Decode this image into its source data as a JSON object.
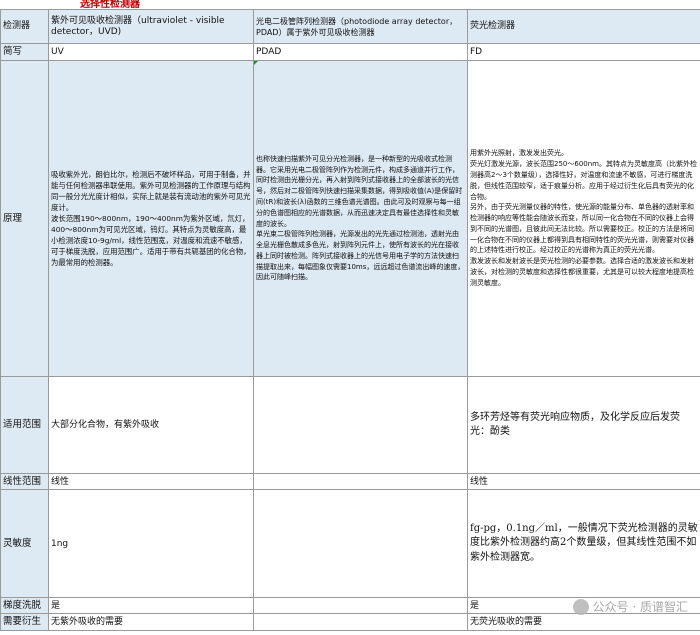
{
  "tag": "选择性检测器",
  "header": {
    "label": "检测器",
    "uv": "紫外可见吸收检测器（ultraviolet - visible detector，UVD)",
    "pdad": "光电二极管阵列检测器（photodiode array detector，PDAD）属于紫外可见吸收检测器",
    "fd": "荧光检测器"
  },
  "abbr": {
    "label": "简写",
    "uv": "UV",
    "pdad": "PDAD",
    "fd": "FD"
  },
  "principle": {
    "label": "原理",
    "uv": "吸收紫外光，朗伯比尔，检测后不破坏样品，可用于制备，并能与任何检测器串联使用。紫外可见检测器的工作原理与结构同一般分光光度计相似，实际上就是装有流动池的紫外可见光度计。\n波长范围190～800nm，190～400nm为紫外区域，氘灯，400～800nm为可见光区域，钨灯。其特点为灵敏度高，最小检测浓度10-9g/ml，线性范围宽，对温度和流速不敏感，可于梯度洗脱，应用范围广。适用于带有共轭基团的化合物，为最常用的检测器。",
    "pdad": "也称快速扫描紫外可见分光检测器，是一种新型的光吸收式检测器。它采用光电二极管阵列作为检测元件，构成多通道并行工作，同时检测由光栅分光，再入射到阵列式接收器上的全部波长的光信号，然后对二极管阵列快速扫描采集数据，得到吸收值(A)是保留时间(tR)和波长(λ)函数的三维色谱光谱图。由此可及时观察与每一组分的色谱图相应的光谱数据，从而迅速决定具有最佳选择性和灵敏度的波长。\n单光束二极管阵列检测器，光源发出的光先通过检测池，透射光由全息光栅色散成多色光，射到阵列元件上，使所有波长的光在接收器上同时被检测。阵列式接收器上的光信号用电子学的方法快速扫描提取出来，每幅图象仅需要10ms，远远超过色谱流出峰的速度，因此可随峰扫描。",
    "fd": "用紫外光照射，激发发出荧光。\n荧光灯激发光源，波长范围250～600nm。其特点为灵敏度高（比紫外检测器高2～3个数量级），选择性好，对温度和流速不敏感，可进行梯度洗脱，但线性范围较窄，适于痕量分析。应用于经过衍生化后具有荧光的化合物。\n另外，由于荧光测量仪器的特性，使光源的能量分布、单色器的透射率和检测器的响应等性能会随波长而变，所以同一化合物在不同的仪器上会得到不同的光谱图，且彼此间无法比较。所以需要校正。校正的方法是将同一化合物在不同的仪器上都得到具有相同特性的荧光光谱，则需要对仪器的上述特性进行校正。经过校正的光谱称为真正的荧光光谱。\n激发波长和发射波长是荧光检测的必要参数。选择合适的激发波长和发射波长，对检测的灵敏度和选择性都很重要，尤其是可以较大程度地提高检测灵敏度。"
  },
  "scope": {
    "label": "适用范围",
    "uv": "大部分化合物，有紫外吸收",
    "pdad": "",
    "fd": "多环芳烃等有荧光响应物质，及化学反应后发荧光：酚类"
  },
  "linear": {
    "label": "线性范围",
    "uv": "线性",
    "pdad": "",
    "fd": "线性"
  },
  "sensitivity": {
    "label": "灵敏度",
    "uv": "1ng",
    "pdad": "",
    "fd": "fg-pg，0.1ng／ml，一般情况下荧光检测器的灵敏度比紫外检测器约高2个数量级，但其线性范围不如紫外检测器宽。"
  },
  "gradient": {
    "label": "梯度洗脱",
    "uv": "是",
    "pdad": "",
    "fd": "是"
  },
  "deriv": {
    "label": "需要衍生",
    "uv": "无紫外吸收的需要",
    "pdad": "",
    "fd": "无荧光吸收的需要"
  },
  "watermark": "公众号 · 质谱智汇",
  "colors": {
    "header_bg": "#dde9f3",
    "tag": "#c00000",
    "border": "#9a9a9a"
  }
}
